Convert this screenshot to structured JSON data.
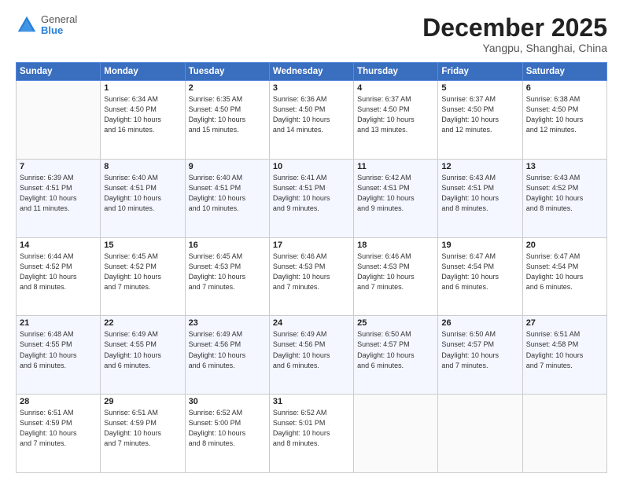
{
  "header": {
    "logo": {
      "general": "General",
      "blue": "Blue"
    },
    "title": "December 2025",
    "subtitle": "Yangpu, Shanghai, China"
  },
  "weekdays": [
    "Sunday",
    "Monday",
    "Tuesday",
    "Wednesday",
    "Thursday",
    "Friday",
    "Saturday"
  ],
  "weeks": [
    [
      {
        "day": null,
        "info": null
      },
      {
        "day": "1",
        "info": "Sunrise: 6:34 AM\nSunset: 4:50 PM\nDaylight: 10 hours\nand 16 minutes."
      },
      {
        "day": "2",
        "info": "Sunrise: 6:35 AM\nSunset: 4:50 PM\nDaylight: 10 hours\nand 15 minutes."
      },
      {
        "day": "3",
        "info": "Sunrise: 6:36 AM\nSunset: 4:50 PM\nDaylight: 10 hours\nand 14 minutes."
      },
      {
        "day": "4",
        "info": "Sunrise: 6:37 AM\nSunset: 4:50 PM\nDaylight: 10 hours\nand 13 minutes."
      },
      {
        "day": "5",
        "info": "Sunrise: 6:37 AM\nSunset: 4:50 PM\nDaylight: 10 hours\nand 12 minutes."
      },
      {
        "day": "6",
        "info": "Sunrise: 6:38 AM\nSunset: 4:50 PM\nDaylight: 10 hours\nand 12 minutes."
      }
    ],
    [
      {
        "day": "7",
        "info": "Sunrise: 6:39 AM\nSunset: 4:51 PM\nDaylight: 10 hours\nand 11 minutes."
      },
      {
        "day": "8",
        "info": "Sunrise: 6:40 AM\nSunset: 4:51 PM\nDaylight: 10 hours\nand 10 minutes."
      },
      {
        "day": "9",
        "info": "Sunrise: 6:40 AM\nSunset: 4:51 PM\nDaylight: 10 hours\nand 10 minutes."
      },
      {
        "day": "10",
        "info": "Sunrise: 6:41 AM\nSunset: 4:51 PM\nDaylight: 10 hours\nand 9 minutes."
      },
      {
        "day": "11",
        "info": "Sunrise: 6:42 AM\nSunset: 4:51 PM\nDaylight: 10 hours\nand 9 minutes."
      },
      {
        "day": "12",
        "info": "Sunrise: 6:43 AM\nSunset: 4:51 PM\nDaylight: 10 hours\nand 8 minutes."
      },
      {
        "day": "13",
        "info": "Sunrise: 6:43 AM\nSunset: 4:52 PM\nDaylight: 10 hours\nand 8 minutes."
      }
    ],
    [
      {
        "day": "14",
        "info": "Sunrise: 6:44 AM\nSunset: 4:52 PM\nDaylight: 10 hours\nand 8 minutes."
      },
      {
        "day": "15",
        "info": "Sunrise: 6:45 AM\nSunset: 4:52 PM\nDaylight: 10 hours\nand 7 minutes."
      },
      {
        "day": "16",
        "info": "Sunrise: 6:45 AM\nSunset: 4:53 PM\nDaylight: 10 hours\nand 7 minutes."
      },
      {
        "day": "17",
        "info": "Sunrise: 6:46 AM\nSunset: 4:53 PM\nDaylight: 10 hours\nand 7 minutes."
      },
      {
        "day": "18",
        "info": "Sunrise: 6:46 AM\nSunset: 4:53 PM\nDaylight: 10 hours\nand 7 minutes."
      },
      {
        "day": "19",
        "info": "Sunrise: 6:47 AM\nSunset: 4:54 PM\nDaylight: 10 hours\nand 6 minutes."
      },
      {
        "day": "20",
        "info": "Sunrise: 6:47 AM\nSunset: 4:54 PM\nDaylight: 10 hours\nand 6 minutes."
      }
    ],
    [
      {
        "day": "21",
        "info": "Sunrise: 6:48 AM\nSunset: 4:55 PM\nDaylight: 10 hours\nand 6 minutes."
      },
      {
        "day": "22",
        "info": "Sunrise: 6:49 AM\nSunset: 4:55 PM\nDaylight: 10 hours\nand 6 minutes."
      },
      {
        "day": "23",
        "info": "Sunrise: 6:49 AM\nSunset: 4:56 PM\nDaylight: 10 hours\nand 6 minutes."
      },
      {
        "day": "24",
        "info": "Sunrise: 6:49 AM\nSunset: 4:56 PM\nDaylight: 10 hours\nand 6 minutes."
      },
      {
        "day": "25",
        "info": "Sunrise: 6:50 AM\nSunset: 4:57 PM\nDaylight: 10 hours\nand 6 minutes."
      },
      {
        "day": "26",
        "info": "Sunrise: 6:50 AM\nSunset: 4:57 PM\nDaylight: 10 hours\nand 7 minutes."
      },
      {
        "day": "27",
        "info": "Sunrise: 6:51 AM\nSunset: 4:58 PM\nDaylight: 10 hours\nand 7 minutes."
      }
    ],
    [
      {
        "day": "28",
        "info": "Sunrise: 6:51 AM\nSunset: 4:59 PM\nDaylight: 10 hours\nand 7 minutes."
      },
      {
        "day": "29",
        "info": "Sunrise: 6:51 AM\nSunset: 4:59 PM\nDaylight: 10 hours\nand 7 minutes."
      },
      {
        "day": "30",
        "info": "Sunrise: 6:52 AM\nSunset: 5:00 PM\nDaylight: 10 hours\nand 8 minutes."
      },
      {
        "day": "31",
        "info": "Sunrise: 6:52 AM\nSunset: 5:01 PM\nDaylight: 10 hours\nand 8 minutes."
      },
      {
        "day": null,
        "info": null
      },
      {
        "day": null,
        "info": null
      },
      {
        "day": null,
        "info": null
      }
    ]
  ]
}
